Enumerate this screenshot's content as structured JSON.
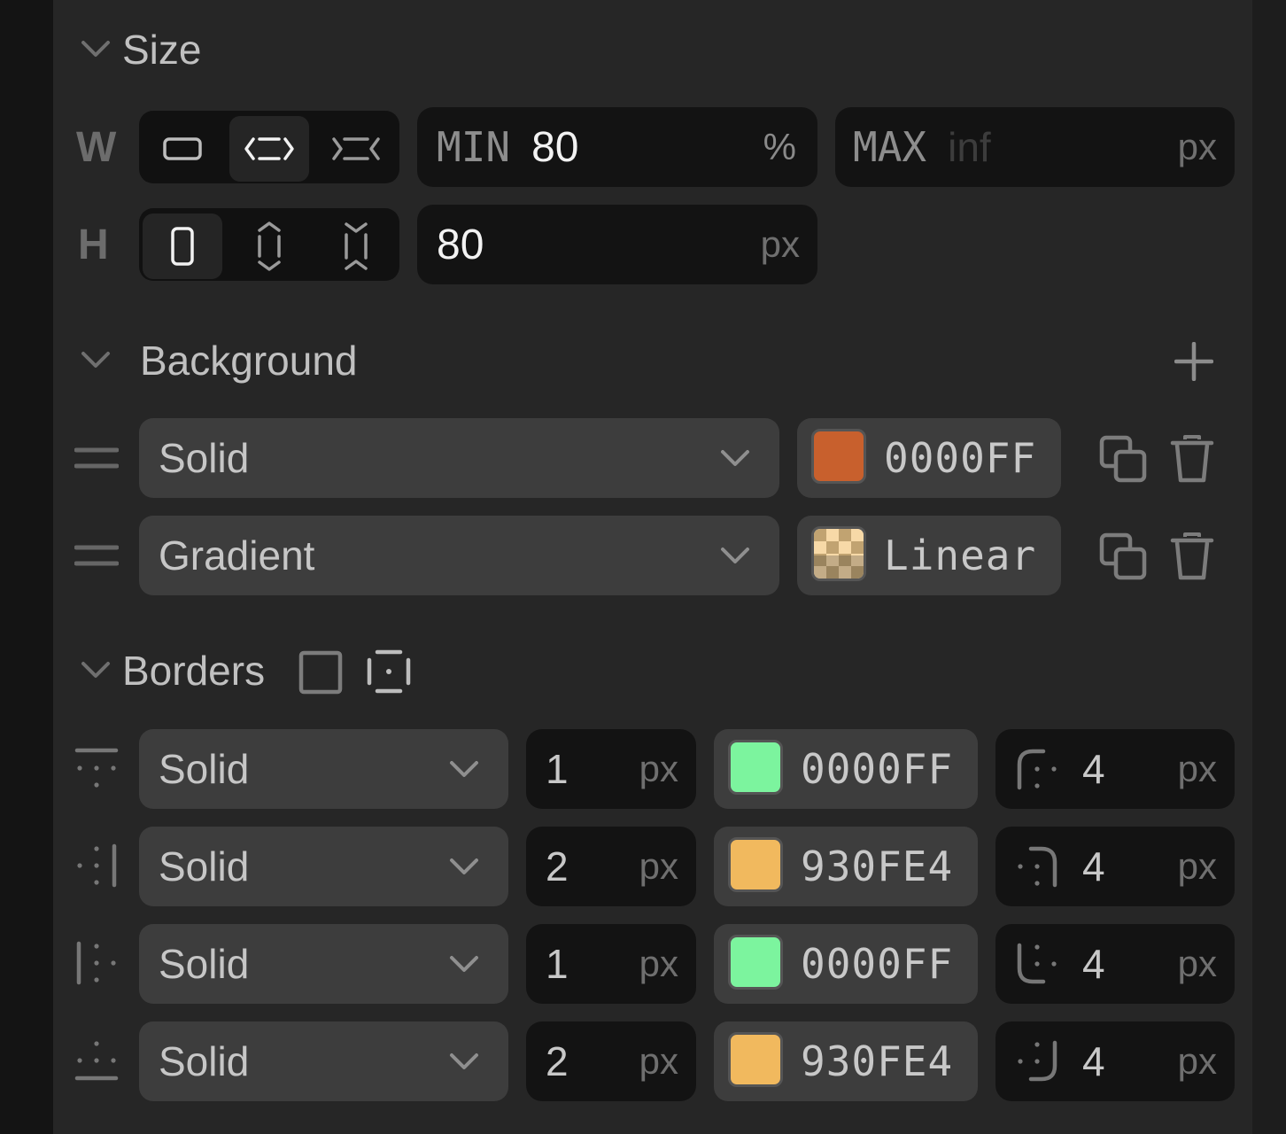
{
  "size": {
    "title": "Size",
    "width": {
      "label": "W",
      "min_label": "MIN",
      "min_value": "80",
      "min_unit": "%",
      "max_label": "MAX",
      "max_placeholder": "inf",
      "max_unit": "px",
      "modes": [
        "fixed-icon",
        "fill-icon",
        "shrink-icon"
      ],
      "active_mode": "fill-icon"
    },
    "height": {
      "label": "H",
      "value": "80",
      "unit": "px",
      "modes": [
        "fixed-icon",
        "fill-icon",
        "shrink-icon"
      ],
      "active_mode": "fixed-icon"
    }
  },
  "background": {
    "title": "Background",
    "layers": [
      {
        "type": "Solid",
        "color_text": "0000FF",
        "swatch": "#c8602d"
      },
      {
        "type": "Gradient",
        "color_text": "Linear",
        "swatch": "checker"
      }
    ]
  },
  "borders": {
    "title": "Borders",
    "rows": [
      {
        "side": "top",
        "style": "Solid",
        "width": "1",
        "width_unit": "px",
        "color_text": "0000FF",
        "swatch": "#7cf49e",
        "radius": "4",
        "radius_unit": "px",
        "corner": "top-left"
      },
      {
        "side": "right",
        "style": "Solid",
        "width": "2",
        "width_unit": "px",
        "color_text": "930FE4",
        "swatch": "#f1b95e",
        "radius": "4",
        "radius_unit": "px",
        "corner": "top-right"
      },
      {
        "side": "left",
        "style": "Solid",
        "width": "1",
        "width_unit": "px",
        "color_text": "0000FF",
        "swatch": "#7cf49e",
        "radius": "4",
        "radius_unit": "px",
        "corner": "bottom-left"
      },
      {
        "side": "bottom",
        "style": "Solid",
        "width": "2",
        "width_unit": "px",
        "color_text": "930FE4",
        "swatch": "#f1b95e",
        "radius": "4",
        "radius_unit": "px",
        "corner": "bottom-right"
      }
    ]
  }
}
